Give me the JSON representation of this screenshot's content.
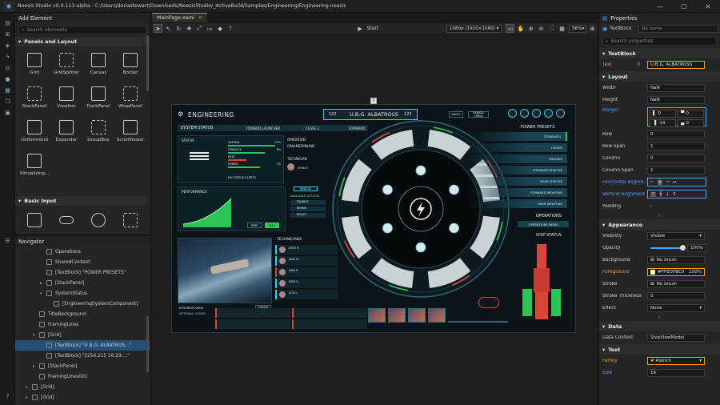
{
  "app": {
    "title": "Noesis Studio v0.0.113-alpha - C:/Users/doriastewart/Downloads/NoesisStudio/_ActiveBuild/Samples/Engineering/Engineering.noesis"
  },
  "add_element": {
    "title": "Add Element",
    "search_placeholder": "Search elements",
    "sections": [
      {
        "title": "Panels and Layout",
        "items": [
          "Grid",
          "GridSplitter",
          "Canvas",
          "Border",
          "StackPanel",
          "Viewbox",
          "DockPanel",
          "WrapPanel",
          "UniformGrid",
          "Expander",
          "GroupBox",
          "ScrollViewer",
          "Virtualizing..."
        ]
      },
      {
        "title": "Basic Input",
        "items": [
          "",
          "",
          "",
          ""
        ]
      }
    ]
  },
  "navigator": {
    "title": "Navigator",
    "rows": [
      {
        "label": "Operations",
        "indent": 3,
        "arrow": ""
      },
      {
        "label": "SharedContent",
        "indent": 3,
        "arrow": ""
      },
      {
        "label": "[TextBlock] \"POWER PRESETS\"",
        "indent": 3,
        "arrow": ""
      },
      {
        "label": "[StackPanel]",
        "indent": 3,
        "arrow": "▸"
      },
      {
        "label": "SystemStatus",
        "indent": 3,
        "arrow": "▾"
      },
      {
        "label": "[EngineeringSystemComponent]",
        "indent": 4,
        "arrow": ""
      },
      {
        "label": "TitleBackground",
        "indent": 2,
        "arrow": ""
      },
      {
        "label": "FramingLines",
        "indent": 2,
        "arrow": ""
      },
      {
        "label": "[Grid]",
        "indent": 2,
        "arrow": "▾"
      },
      {
        "label": "[TextBlock] \"U.B.G. ALBATROS...\"",
        "indent": 3,
        "arrow": "",
        "selected": true
      },
      {
        "label": "[TextBlock] \"2256.215 16:29:...\"",
        "indent": 3,
        "arrow": ""
      },
      {
        "label": "[StackPanel]",
        "indent": 2,
        "arrow": "▸"
      },
      {
        "label": "FramingLines001",
        "indent": 2,
        "arrow": ""
      },
      {
        "label": "[Grid]",
        "indent": 1,
        "arrow": "▸"
      },
      {
        "label": "[Grid]",
        "indent": 1,
        "arrow": "▸"
      }
    ]
  },
  "editor": {
    "tab": "MainPage.xaml",
    "start_label": "Start",
    "resolution": "1080p (1920×1080)",
    "zoom": "56%",
    "marker": "0"
  },
  "game": {
    "header": "ENGINEERING",
    "ship_name": "U.B.G. ALBATROSS",
    "ship_id_left": "122",
    "ship_id_right": "122",
    "btn_1": "RADIO",
    "btn_2": "DAMAGE CHECK",
    "system_status": "SYSTEM STATUS",
    "torpedo": "TORPEDO LAUNCHER",
    "class": "CLASS 3",
    "forward": "FORWARD",
    "status": "STATUS",
    "operation": "OPERATION",
    "online": "ONLINE/ONLINE",
    "technician": "TECHNICIAN",
    "tech_name": "JOHN F.",
    "no_status": "NO STATUS ALERTS",
    "performance": "PERFORMANCE",
    "available_actions": "AVAILABLE ACTIONS",
    "actions": [
      "DISABLE",
      "REPAIR",
      "BOOST"
    ],
    "shield_btn": "SHIELDS",
    "perf_btn": "PERF",
    "max_btn": "MAX",
    "power_presets": "POWER PRESETS",
    "presets": [
      "STANDARD",
      "CRUISE",
      "ENGINES",
      "FORWARD SHIELDS",
      "REAR SHIELDS",
      "FORWARD WEAPONS",
      "REAR WEAPONS"
    ],
    "operations": "OPERATIONS",
    "ops_menu": "OPERATIONS MENU",
    "ship_status": "SHIP STATUS",
    "technicians": "TECHNICIANS",
    "tech_list": [
      "JOSH R.",
      "JAKE M.",
      "MAX P.",
      "RISE S.",
      "LOU L."
    ],
    "exterior_view": "EXTERIOR VIEW",
    "camera_btn": "CAMERA",
    "internal_comms": "INTERNAL COMMS",
    "status_labels": [
      "OXYGEN",
      "STABILITY",
      "HEAT",
      "POWER"
    ],
    "status_values": [
      "27%",
      "8%",
      "",
      "7%"
    ],
    "colors": {
      "accent": "#3ec9e6",
      "red": "#d9473c",
      "green": "#3ecf5a",
      "panel": "#12232b"
    }
  },
  "props": {
    "title": "Properties",
    "type": "TextBlock",
    "name_placeholder": "No name",
    "search_placeholder": "Search properties",
    "sec_textblock": "TextBlock",
    "text_label": "Text",
    "text_value": "U.B.G. ALBATROSS",
    "sec_layout": "Layout",
    "width_label": "Width",
    "width": "NaN",
    "height_label": "Height",
    "height": "NaN",
    "margin_label": "Margin",
    "margin": [
      "0",
      "0",
      "-14",
      "0"
    ],
    "row_label": "Row",
    "row": "0",
    "rowspan_label": "Row Span",
    "rowspan": "1",
    "col_label": "Column",
    "col": "0",
    "colspan_label": "Column Span",
    "colspan": "1",
    "halign_label": "Horizontal Alignm...",
    "valign_label": "Vertical Alignment",
    "padding_label": "Padding",
    "sec_appearance": "Appearance",
    "vis_label": "Visibility",
    "vis": "Visible",
    "opacity_label": "Opacity",
    "opacity": "100%",
    "bg_label": "Background",
    "bg": "No brush",
    "fg_label": "Foreground",
    "fg": "#FFEDFBC0",
    "fg_pct": "100%",
    "stroke_label": "Stroke",
    "stroke": "No brush",
    "stroketh_label": "Stroke Thickness",
    "stroketh": "0",
    "effect_label": "Effect",
    "effect": "None",
    "sec_data": "Data",
    "dc_label": "Data Context",
    "dc": "ShipViewModel",
    "sec_text": "Text",
    "family_label": "Family",
    "family": "# Aldrich",
    "size_label": "Size",
    "size": "16"
  }
}
